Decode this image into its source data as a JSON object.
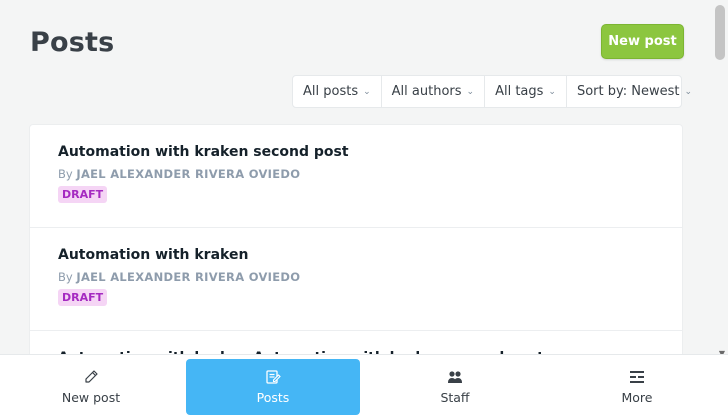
{
  "header": {
    "title": "Posts",
    "new_post_label": "New post"
  },
  "filters": [
    {
      "label": "All posts",
      "icon": "chevron-down-icon"
    },
    {
      "label": "All authors",
      "icon": "chevron-down-icon"
    },
    {
      "label": "All tags",
      "icon": "chevron-down-icon"
    },
    {
      "label": "Sort by: Newest",
      "icon": "chevron-down-icon"
    }
  ],
  "posts": [
    {
      "title": "Automation with kraken second post",
      "by": "By",
      "author": "JAEL ALEXANDER RIVERA OVIEDO",
      "status": "DRAFT"
    },
    {
      "title": "Automation with kraken",
      "by": "By",
      "author": "JAEL ALEXANDER RIVERA OVIEDO",
      "status": "DRAFT"
    },
    {
      "title": "Automation with kraken Automation with kraken second post",
      "by": "",
      "author": "",
      "status": ""
    }
  ],
  "bottom_nav": [
    {
      "label": "New post",
      "icon": "pencil-icon",
      "active": false
    },
    {
      "label": "Posts",
      "icon": "edit-document-icon",
      "active": true
    },
    {
      "label": "Staff",
      "icon": "people-icon",
      "active": false
    },
    {
      "label": "More",
      "icon": "menu-icon",
      "active": false
    }
  ],
  "colors": {
    "accent_green": "#8cc63f",
    "active_blue": "#45b6f5",
    "draft_bg": "#f5d5f5",
    "draft_text": "#a52ac1"
  }
}
